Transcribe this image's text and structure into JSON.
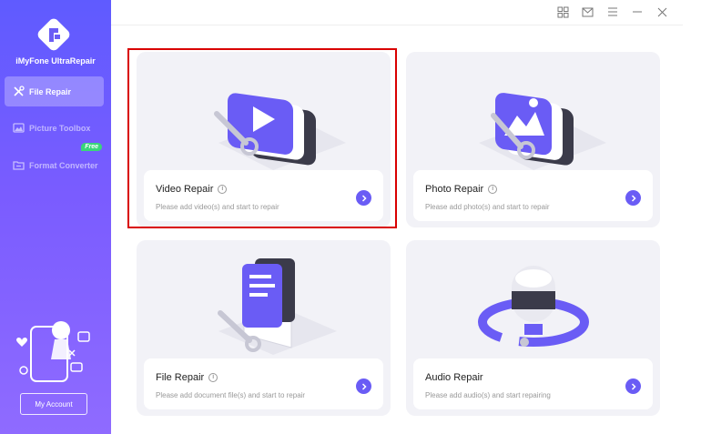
{
  "app": {
    "name": "iMyFone UltraRepair"
  },
  "sidebar": {
    "items": [
      {
        "label": "File Repair",
        "icon": "wrench-screwdriver-icon",
        "active": true
      },
      {
        "label": "Picture Toolbox",
        "icon": "picture-icon",
        "active": false
      },
      {
        "label": "Format Converter",
        "icon": "folder-convert-icon",
        "active": false,
        "badge": "Free"
      }
    ],
    "account_label": "My Account"
  },
  "titlebar": {
    "icons": [
      "grid-icon",
      "mail-icon",
      "menu-icon",
      "minimize-icon",
      "close-icon"
    ]
  },
  "cards": [
    {
      "title": "Video Repair",
      "desc": "Please add video(s) and start to repair",
      "icon": "video-illustration"
    },
    {
      "title": "Photo Repair",
      "desc": "Please add photo(s) and start to repair",
      "icon": "photo-illustration"
    },
    {
      "title": "File Repair",
      "desc": "Please add document file(s) and start to repair",
      "icon": "document-illustration"
    },
    {
      "title": "Audio Repair",
      "desc": "Please add audio(s) and start repairing",
      "icon": "audio-illustration"
    }
  ],
  "colors": {
    "accent": "#6a5cf5",
    "sidebar_top": "#5f5bff",
    "sidebar_bottom": "#8f6bff",
    "highlight": "#d90000",
    "free_badge": "#39d67a"
  }
}
